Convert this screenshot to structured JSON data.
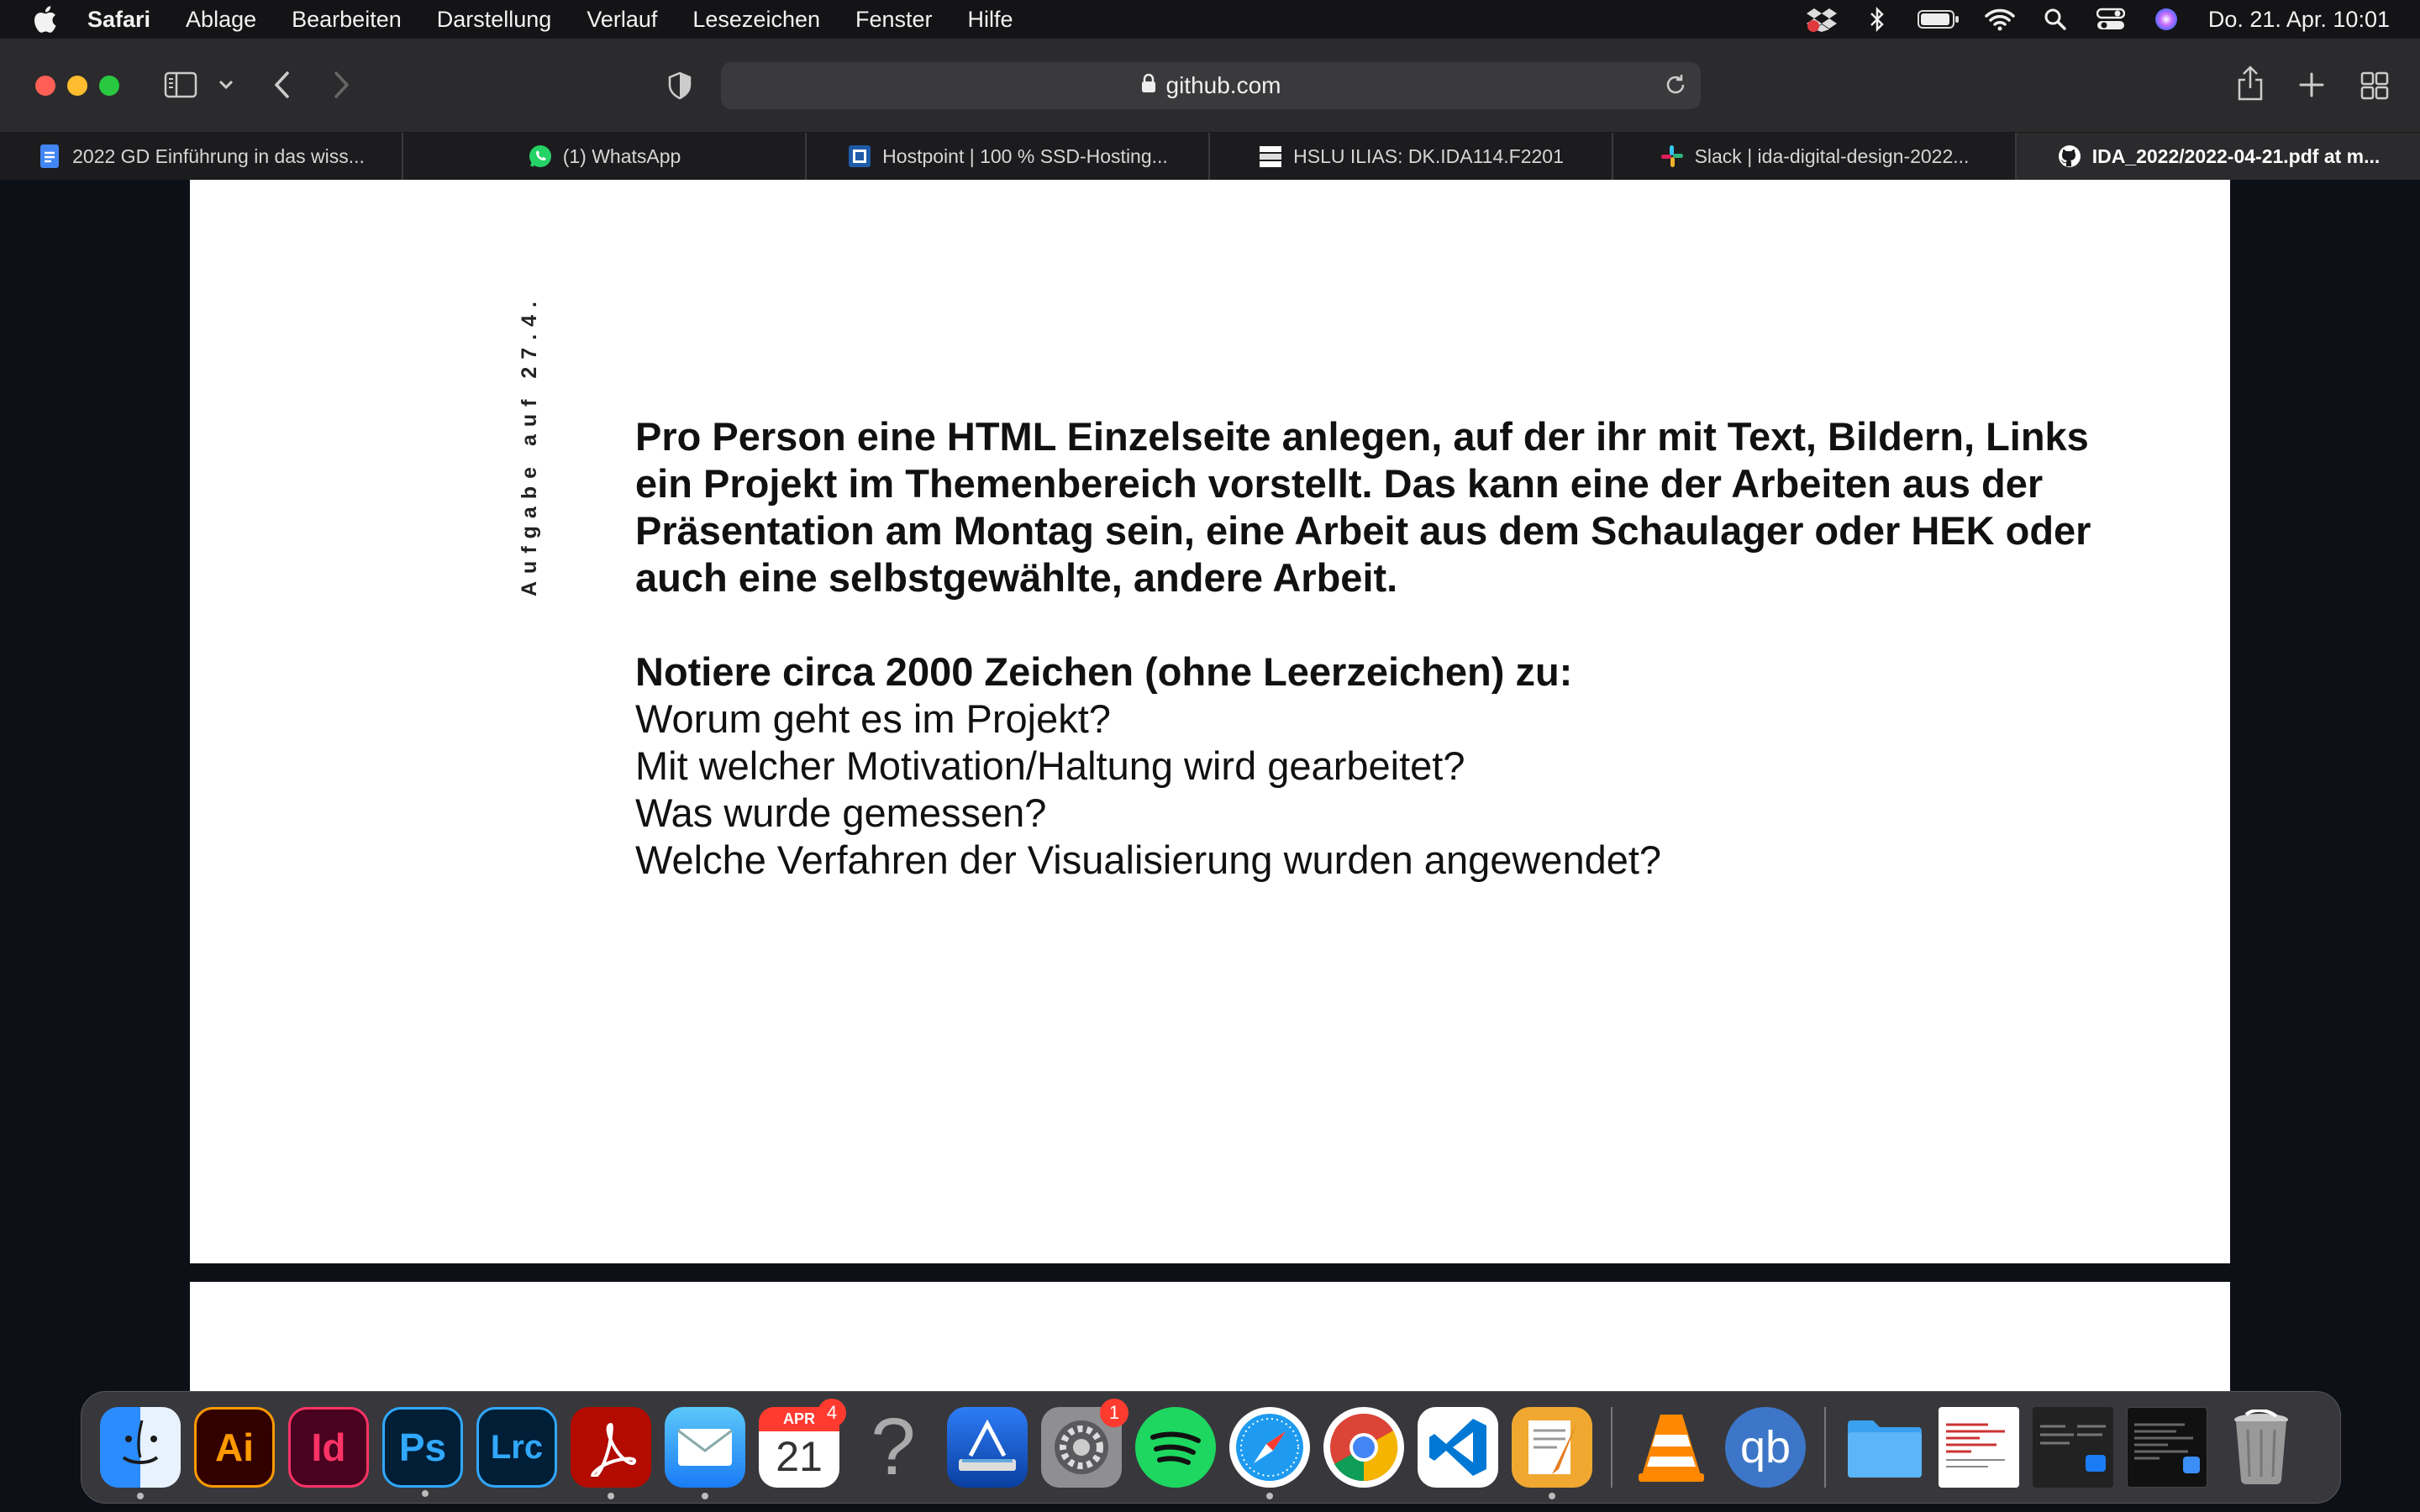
{
  "menubar": {
    "app_name": "Safari",
    "items": [
      "Ablage",
      "Bearbeiten",
      "Darstellung",
      "Verlauf",
      "Lesezeichen",
      "Fenster",
      "Hilfe"
    ],
    "clock": "Do. 21. Apr.  10:01"
  },
  "toolbar": {
    "url": "github.com"
  },
  "tabs": [
    {
      "label": "2022 GD Einführung in das wiss...",
      "icon": "google-docs-icon",
      "active": false
    },
    {
      "label": "(1) WhatsApp",
      "icon": "whatsapp-icon",
      "active": false
    },
    {
      "label": "Hostpoint | 100 % SSD-Hosting...",
      "icon": "hostpoint-icon",
      "active": false
    },
    {
      "label": "HSLU ILIAS: DK.IDA114.F2201",
      "icon": "ilias-icon",
      "active": false
    },
    {
      "label": "Slack | ida-digital-design-2022...",
      "icon": "slack-icon",
      "active": false
    },
    {
      "label": "IDA_2022/2022-04-21.pdf at m...",
      "icon": "github-icon",
      "active": true
    }
  ],
  "document": {
    "vertical_label": "Aufgabe auf  27.4.",
    "bold_paragraph_lines": [
      "Pro Person eine HTML Einzelseite anlegen, auf der ihr mit Text, Bildern, Links",
      "ein Projekt im Themenbereich vorstellt. Das kann eine der Arbeiten aus der",
      "Präsentation am Montag sein, eine Arbeit aus dem Schaulager oder HEK oder",
      "auch eine selbstgewählte, andere Arbeit."
    ],
    "questions_heading": "Notiere circa 2000 Zeichen (ohne Leerzeichen) zu:",
    "questions": [
      "Worum geht es im Projekt?",
      "Mit welcher Motivation/Haltung wird gearbeitet?",
      "Was wurde gemessen?",
      "Welche Verfahren der Visualisierung wurden angewendet?"
    ]
  },
  "dock": {
    "illustrator_label": "Ai",
    "indesign_label": "Id",
    "photoshop_label": "Ps",
    "lightroom_label": "Lrc",
    "calendar_month": "APR",
    "calendar_day": "21",
    "calendar_badge": "4",
    "help_glyph": "?",
    "settings_badge": "1",
    "qbittorrent_label": "qb"
  },
  "colors": {
    "accent_red": "#ff3b30",
    "page_background": "#ffffff",
    "viewer_background": "#0d1117"
  }
}
